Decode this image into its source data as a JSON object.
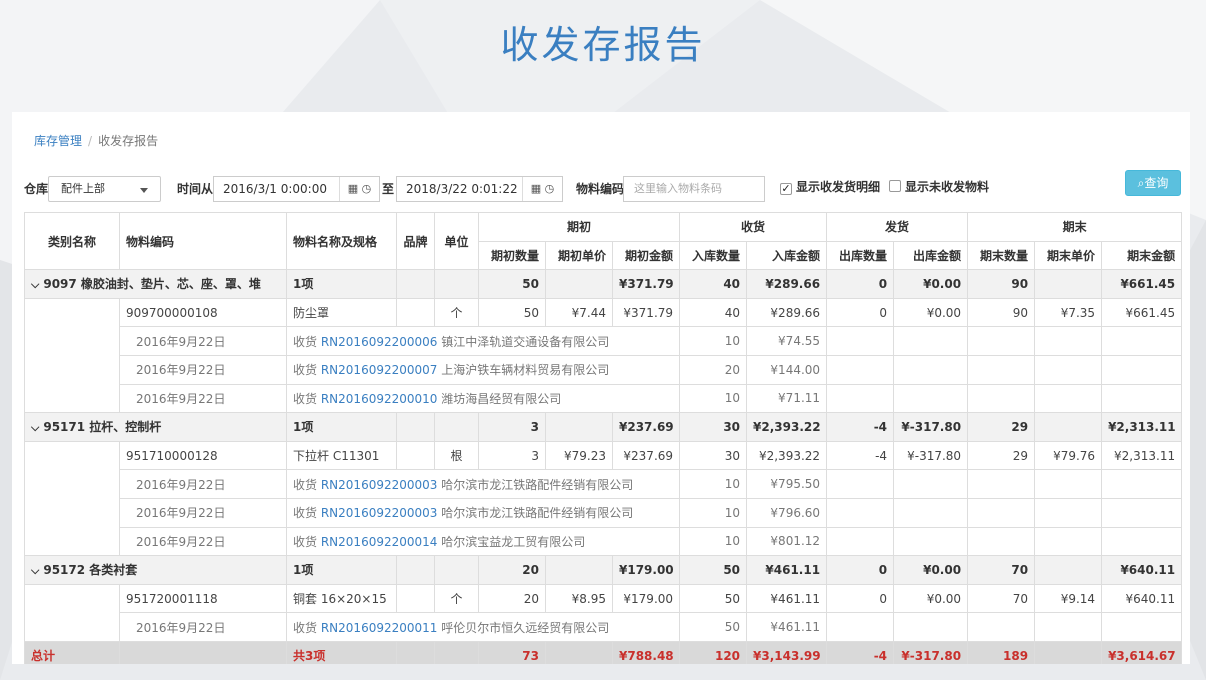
{
  "page": {
    "title": "收发存报告"
  },
  "breadcrumb": {
    "parent": "库存管理",
    "separator": "/",
    "current": "收发存报告"
  },
  "filters": {
    "warehouse_label": "仓库",
    "warehouse_value": "配件上部",
    "time_from_label": "时间从",
    "time_from_value": "2016/3/1 0:00:00",
    "time_to_label": "至",
    "time_to_value": "2018/3/22 0:01:22",
    "material_code_label": "物料编码",
    "material_code_placeholder": "这里输入物料条码",
    "show_detail_label": "显示收发货明细",
    "show_detail_checked": true,
    "show_unmoved_label": "显示未收发物料",
    "show_unmoved_checked": false,
    "query_button": "查询",
    "calendar_icon": "calendar-icon",
    "clock_icon": "clock-icon",
    "search_icon": "search-icon"
  },
  "table": {
    "headers": {
      "category": "类别名称",
      "code": "物料编码",
      "name": "物料名称及规格",
      "brand": "品牌",
      "unit": "单位",
      "opening": "期初",
      "receipt": "收货",
      "issue": "发货",
      "closing": "期末",
      "opening_qty": "期初数量",
      "opening_price": "期初单价",
      "opening_amount": "期初金额",
      "in_qty": "入库数量",
      "in_amount": "入库金额",
      "out_qty": "出库数量",
      "out_amount": "出库金额",
      "closing_qty": "期末数量",
      "closing_price": "期末单价",
      "closing_amount": "期末金额"
    },
    "groups": [
      {
        "name": "9097 橡胶油封、垫片、芯、座、罩、堆",
        "count": "1项",
        "open_qty": "50",
        "open_amt": "¥371.79",
        "in_qty": "40",
        "in_amt": "¥289.66",
        "out_qty": "0",
        "out_amt": "¥0.00",
        "close_qty": "90",
        "close_amt": "¥661.45",
        "item": {
          "code": "909700000108",
          "name": "防尘罩",
          "unit": "个",
          "open_qty": "50",
          "open_price": "¥7.44",
          "open_amt": "¥371.79",
          "in_qty": "40",
          "in_amt": "¥289.66",
          "out_qty": "0",
          "out_amt": "¥0.00",
          "close_qty": "90",
          "close_price": "¥7.35",
          "close_amt": "¥661.45"
        },
        "details": [
          {
            "date": "2016年9月22日",
            "type": "收货",
            "rn": "RN2016092200006",
            "supplier": "镇江中泽轨道交通设备有限公司",
            "in_qty": "10",
            "in_amt": "¥74.55"
          },
          {
            "date": "2016年9月22日",
            "type": "收货",
            "rn": "RN2016092200007",
            "supplier": "上海沪铁车辆材料贸易有限公司",
            "in_qty": "20",
            "in_amt": "¥144.00"
          },
          {
            "date": "2016年9月22日",
            "type": "收货",
            "rn": "RN2016092200010",
            "supplier": "潍坊海昌经贸有限公司",
            "in_qty": "10",
            "in_amt": "¥71.11"
          }
        ]
      },
      {
        "name": "95171 拉杆、控制杆",
        "count": "1项",
        "open_qty": "3",
        "open_amt": "¥237.69",
        "in_qty": "30",
        "in_amt": "¥2,393.22",
        "out_qty": "-4",
        "out_amt": "¥-317.80",
        "close_qty": "29",
        "close_amt": "¥2,313.11",
        "item": {
          "code": "951710000128",
          "name": "下拉杆 C11301",
          "unit": "根",
          "open_qty": "3",
          "open_price": "¥79.23",
          "open_amt": "¥237.69",
          "in_qty": "30",
          "in_amt": "¥2,393.22",
          "out_qty": "-4",
          "out_amt": "¥-317.80",
          "close_qty": "29",
          "close_price": "¥79.76",
          "close_amt": "¥2,313.11"
        },
        "details": [
          {
            "date": "2016年9月22日",
            "type": "收货",
            "rn": "RN2016092200003",
            "supplier": "哈尔滨市龙江铁路配件经销有限公司",
            "in_qty": "10",
            "in_amt": "¥795.50"
          },
          {
            "date": "2016年9月22日",
            "type": "收货",
            "rn": "RN2016092200003",
            "supplier": "哈尔滨市龙江铁路配件经销有限公司",
            "in_qty": "10",
            "in_amt": "¥796.60"
          },
          {
            "date": "2016年9月22日",
            "type": "收货",
            "rn": "RN2016092200014",
            "supplier": "哈尔滨宝益龙工贸有限公司",
            "in_qty": "10",
            "in_amt": "¥801.12"
          }
        ]
      },
      {
        "name": "95172 各类衬套",
        "count": "1项",
        "open_qty": "20",
        "open_amt": "¥179.00",
        "in_qty": "50",
        "in_amt": "¥461.11",
        "out_qty": "0",
        "out_amt": "¥0.00",
        "close_qty": "70",
        "close_amt": "¥640.11",
        "item": {
          "code": "951720001118",
          "name": "铜套 16×20×15",
          "unit": "个",
          "open_qty": "20",
          "open_price": "¥8.95",
          "open_amt": "¥179.00",
          "in_qty": "50",
          "in_amt": "¥461.11",
          "out_qty": "0",
          "out_amt": "¥0.00",
          "close_qty": "70",
          "close_price": "¥9.14",
          "close_amt": "¥640.11"
        },
        "details": [
          {
            "date": "2016年9月22日",
            "type": "收货",
            "rn": "RN2016092200011",
            "supplier": "呼伦贝尔市恒久远经贸有限公司",
            "in_qty": "50",
            "in_amt": "¥461.11"
          }
        ]
      }
    ],
    "total": {
      "label": "总计",
      "count": "共3项",
      "open_qty": "73",
      "open_amt": "¥788.48",
      "in_qty": "120",
      "in_amt": "¥3,143.99",
      "out_qty": "-4",
      "out_amt": "¥-317.80",
      "close_qty": "189",
      "close_amt": "¥3,614.67"
    }
  }
}
